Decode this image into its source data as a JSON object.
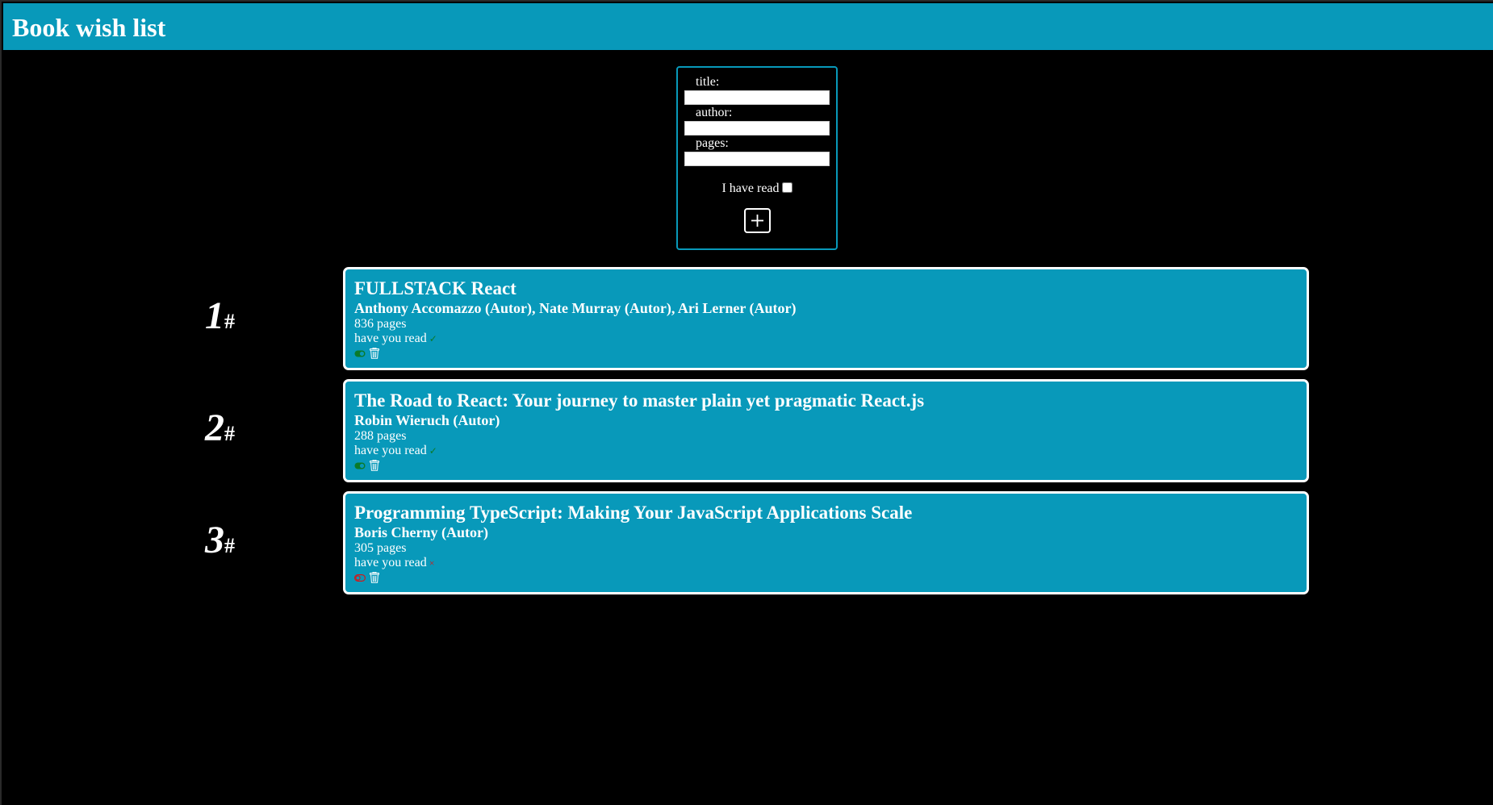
{
  "header": {
    "title": "Book wish list"
  },
  "form": {
    "title_label": "title:",
    "author_label": "author:",
    "pages_label": "pages:",
    "title_value": "",
    "author_value": "",
    "pages_value": "",
    "read_label": "I have read",
    "read_checked": false,
    "add_icon": "plus-icon"
  },
  "books": [
    {
      "index": "1",
      "hash": "#",
      "title": "FULLSTACK React",
      "author": "Anthony Accomazzo (Autor), Nate Murray (Autor), Ari Lerner (Autor)",
      "pages": "836 pages",
      "read_label": "have you read",
      "read": true,
      "read_mark": "✓",
      "toggle_icon": "toggle-on-icon",
      "delete_icon": "trash-icon"
    },
    {
      "index": "2",
      "hash": "#",
      "title": "The Road to React: Your journey to master plain yet pragmatic React.js",
      "author": "Robin Wieruch (Autor)",
      "pages": "288 pages",
      "read_label": "have you read",
      "read": true,
      "read_mark": "✓",
      "toggle_icon": "toggle-on-icon",
      "delete_icon": "trash-icon"
    },
    {
      "index": "3",
      "hash": "#",
      "title": "Programming TypeScript: Making Your JavaScript Applications Scale",
      "author": "Boris Cherny (Autor)",
      "pages": "305 pages",
      "read_label": "have you read",
      "read": false,
      "read_mark": "×",
      "toggle_icon": "toggle-off-icon",
      "delete_icon": "trash-icon"
    }
  ],
  "colors": {
    "accent": "#0899ba",
    "background": "#000000",
    "read_yes": "#0a7a2a",
    "read_no": "#dd1111"
  }
}
